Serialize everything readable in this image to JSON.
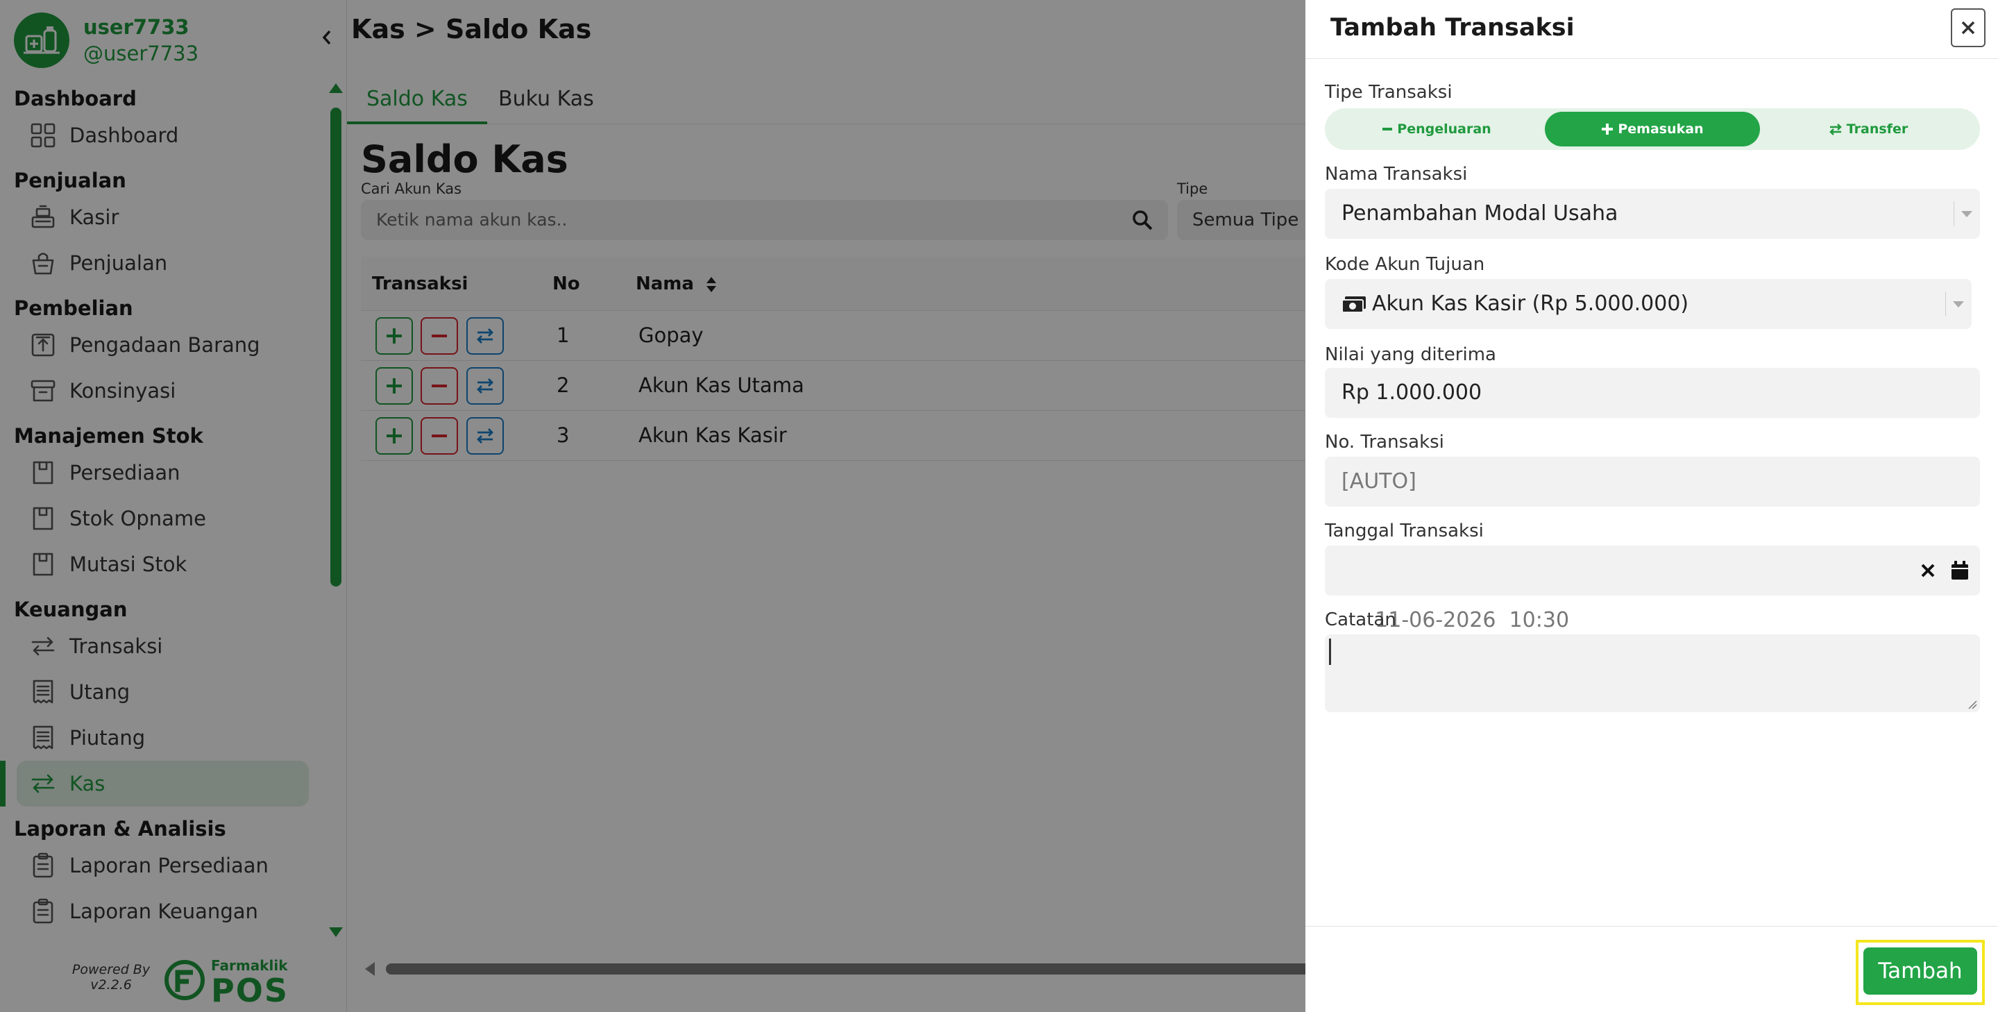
{
  "user": {
    "name": "user7733",
    "handle": "@user7733"
  },
  "sidebar": {
    "sections": [
      {
        "title": "Dashboard",
        "items": [
          {
            "label": "Dashboard",
            "icon": "grid-icon"
          }
        ]
      },
      {
        "title": "Penjualan",
        "items": [
          {
            "label": "Kasir",
            "icon": "cash-register-icon"
          },
          {
            "label": "Penjualan",
            "icon": "shopping-basket-icon"
          }
        ]
      },
      {
        "title": "Pembelian",
        "items": [
          {
            "label": "Pengadaan Barang",
            "icon": "upload-box-icon"
          },
          {
            "label": "Konsinyasi",
            "icon": "archive-box-icon"
          }
        ]
      },
      {
        "title": "Manajemen Stok",
        "items": [
          {
            "label": "Persediaan",
            "icon": "box-icon"
          },
          {
            "label": "Stok Opname",
            "icon": "box-icon"
          },
          {
            "label": "Mutasi Stok",
            "icon": "box-icon"
          }
        ]
      },
      {
        "title": "Keuangan",
        "items": [
          {
            "label": "Transaksi",
            "icon": "transfer-icon"
          },
          {
            "label": "Utang",
            "icon": "receipt-icon"
          },
          {
            "label": "Piutang",
            "icon": "receipt-icon"
          },
          {
            "label": "Kas",
            "icon": "transfer-icon",
            "active": true
          }
        ]
      },
      {
        "title": "Laporan & Analisis",
        "items": [
          {
            "label": "Laporan Persediaan",
            "icon": "clipboard-icon"
          },
          {
            "label": "Laporan Keuangan",
            "icon": "clipboard-icon"
          }
        ]
      }
    ],
    "powered_by": "Powered By",
    "version": "v2.2.6",
    "brand_top": "Farmaklik",
    "brand_main": "POS"
  },
  "main": {
    "breadcrumb": "Kas > Saldo Kas",
    "tabs": [
      "Saldo Kas",
      "Buku Kas"
    ],
    "title": "Saldo Kas",
    "search_label": "Cari Akun Kas",
    "search_placeholder": "Ketik nama akun kas..",
    "type_label": "Tipe",
    "type_value": "Semua Tipe",
    "table": {
      "headers": [
        "Transaksi",
        "No",
        "Nama"
      ],
      "rows": [
        {
          "no": "1",
          "name": "Gopay"
        },
        {
          "no": "2",
          "name": "Akun Kas Utama"
        },
        {
          "no": "3",
          "name": "Akun Kas Kasir"
        }
      ]
    }
  },
  "drawer": {
    "title": "Tambah Transaksi",
    "type_label": "Tipe Transaksi",
    "types": [
      "Pengeluaran",
      "Pemasukan",
      "Transfer"
    ],
    "selected_type": "Pemasukan",
    "name_label": "Nama Transaksi",
    "name_value": "Penambahan Modal Usaha",
    "account_label": "Kode Akun Tujuan",
    "account_value": "Akun Kas Kasir (Rp 5.000.000)",
    "amount_label": "Nilai yang diterima",
    "amount_value": "Rp 1.000.000",
    "number_label": "No. Transaksi",
    "number_value": "[AUTO]",
    "date_label": "Tanggal Transaksi",
    "date_value": "11-06-2026  10:30",
    "note_label": "Catatan",
    "note_value": "",
    "submit_label": "Tambah"
  },
  "colors": {
    "brand": "#1f9a3e",
    "danger": "#d9262c",
    "info": "#1b7fc8",
    "highlight": "#f5e61e"
  }
}
